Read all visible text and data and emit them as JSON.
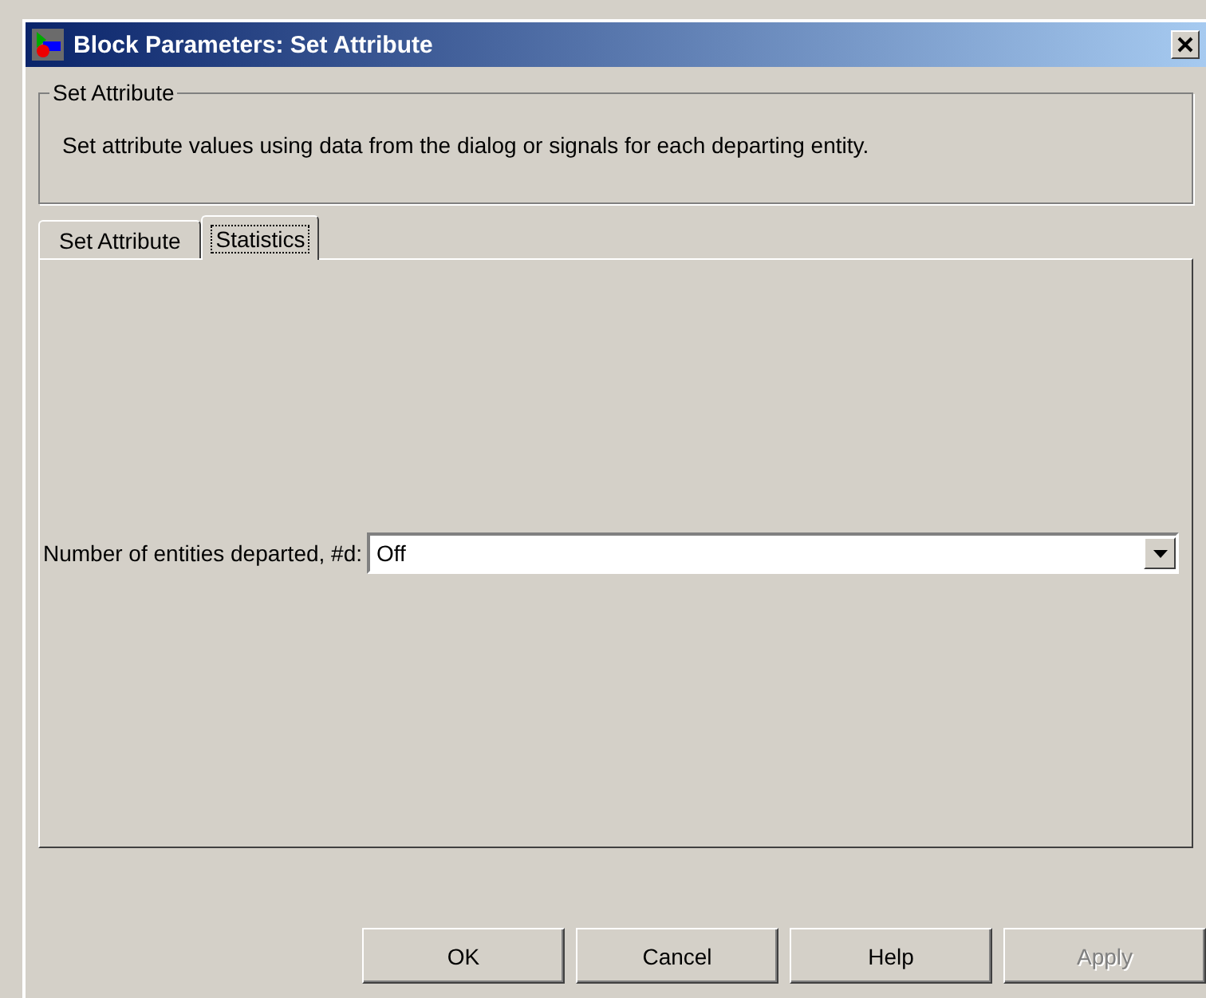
{
  "window": {
    "title": "Block Parameters: Set Attribute"
  },
  "group": {
    "title": "Set Attribute",
    "description": "Set attribute values using data from the dialog or signals for each departing entity."
  },
  "tabs": [
    {
      "label": "Set Attribute",
      "selected": false
    },
    {
      "label": "Statistics",
      "selected": true
    }
  ],
  "field": {
    "label": "Number of entities departed, #d:",
    "value": "Off"
  },
  "buttons": [
    {
      "label": "OK",
      "disabled": false
    },
    {
      "label": "Cancel",
      "disabled": false
    },
    {
      "label": "Help",
      "disabled": false
    },
    {
      "label": "Apply",
      "disabled": true
    }
  ]
}
